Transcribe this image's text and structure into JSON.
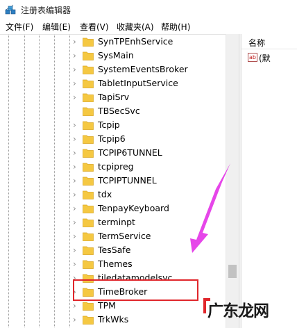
{
  "window": {
    "title": "注册表编辑器",
    "icon": "registry-cubes-icon"
  },
  "menu": [
    {
      "label": "文件(F)"
    },
    {
      "label": "编辑(E)"
    },
    {
      "label": "查看(V)"
    },
    {
      "label": "收藏夹(A)"
    },
    {
      "label": "帮助(H)"
    }
  ],
  "tree": {
    "items": [
      {
        "label": "SynTPEnhService",
        "expandable": true
      },
      {
        "label": "SysMain",
        "expandable": true
      },
      {
        "label": "SystemEventsBroker",
        "expandable": true
      },
      {
        "label": "TabletInputService",
        "expandable": true
      },
      {
        "label": "TapiSrv",
        "expandable": true
      },
      {
        "label": "TBSecSvc",
        "expandable": false
      },
      {
        "label": "Tcpip",
        "expandable": true
      },
      {
        "label": "Tcpip6",
        "expandable": true
      },
      {
        "label": "TCPIP6TUNNEL",
        "expandable": true
      },
      {
        "label": "tcpipreg",
        "expandable": true
      },
      {
        "label": "TCPIPTUNNEL",
        "expandable": true
      },
      {
        "label": "tdx",
        "expandable": true
      },
      {
        "label": "TenpayKeyboard",
        "expandable": true
      },
      {
        "label": "terminpt",
        "expandable": true
      },
      {
        "label": "TermService",
        "expandable": true
      },
      {
        "label": "TesSafe",
        "expandable": true
      },
      {
        "label": "Themes",
        "expandable": true
      },
      {
        "label": "tiledatamodelsvc",
        "expandable": true
      },
      {
        "label": "TimeBroker",
        "expandable": true
      },
      {
        "label": "TPM",
        "expandable": true
      },
      {
        "label": "TrkWks",
        "expandable": true
      }
    ]
  },
  "list": {
    "column_name": "名称",
    "first_value_name": "(默",
    "value_icon_text": "ab"
  },
  "colors": {
    "folder": "#F5C842",
    "highlight": "#E0262B",
    "arrow": "#E53CE8"
  },
  "watermark": {
    "text": "广东龙网"
  }
}
